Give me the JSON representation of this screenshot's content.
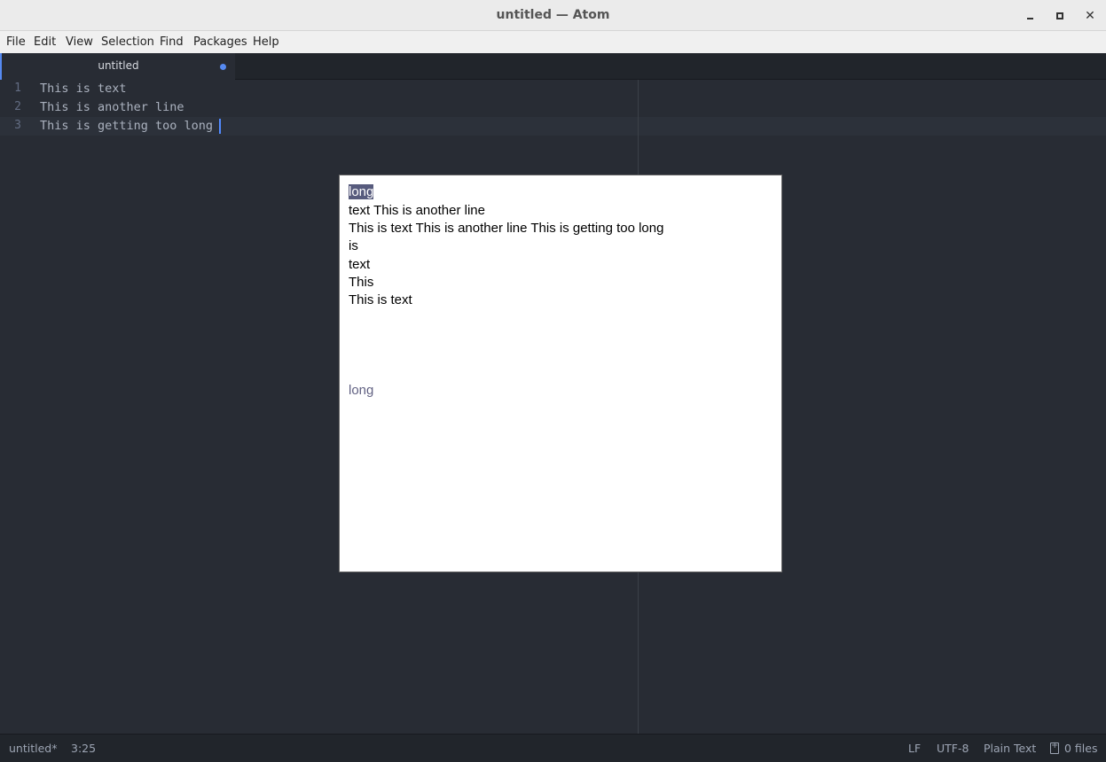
{
  "window": {
    "title": "untitled — Atom"
  },
  "menu": [
    "File",
    "Edit",
    "View",
    "Selection",
    "Find",
    "Packages",
    "Help"
  ],
  "tab": {
    "title": "untitled"
  },
  "editor": {
    "lines": [
      {
        "num": "1",
        "text": "This is text"
      },
      {
        "num": "2",
        "text": "This is another line"
      },
      {
        "num": "3",
        "text": "This is getting too long"
      }
    ]
  },
  "autocomplete": {
    "suggestions": [
      "long",
      "text This is another line",
      "This is text This is another line This is getting too long",
      "is",
      "text",
      "This",
      "This is text"
    ],
    "selected_index": 0,
    "description": "long"
  },
  "status": {
    "file": "untitled*",
    "cursor": "3:25",
    "line_ending": "LF",
    "encoding": "UTF-8",
    "grammar": "Plain Text",
    "files": "0 files"
  },
  "colors": {
    "accent": "#568af2",
    "editor_bg": "#282c34",
    "selection": "#575b7d"
  },
  "icons": [
    "minimize-icon",
    "maximize-icon",
    "close-icon",
    "modified-dot-icon",
    "git-files-icon"
  ]
}
